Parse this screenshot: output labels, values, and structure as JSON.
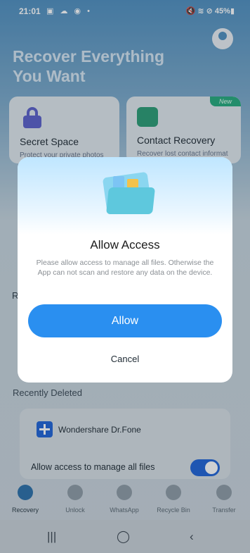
{
  "status_bar": {
    "time": "21:01",
    "left_icons": "▣ ☁ ◉ •",
    "right_icons": "🔇 ≋ ⊘ 45%▮",
    "battery": "45%"
  },
  "header": {
    "title_line1": "Recover Everything",
    "title_line2": "You Want"
  },
  "cards": {
    "secret_space": {
      "title": "Secret Space",
      "subtitle": "Protect your private photos"
    },
    "contact_recovery": {
      "title": "Contact Recovery",
      "subtitle": "Recover lost contact information",
      "badge": "New"
    }
  },
  "section_letter": "R",
  "recent": {
    "label": "Recently Deleted",
    "app_name": "Wondershare Dr.Fone",
    "access_text": "Allow access to manage all files",
    "toggle_on": true
  },
  "bottom_nav": [
    {
      "label": "Recovery",
      "active": true
    },
    {
      "label": "Unlock",
      "active": false
    },
    {
      "label": "WhatsApp",
      "active": false
    },
    {
      "label": "Recycle Bin",
      "active": false
    },
    {
      "label": "Transfer",
      "active": false
    }
  ],
  "system_nav": {
    "recents": "|||",
    "home": "◯",
    "back": "‹"
  },
  "dialog": {
    "title": "Allow Access",
    "message": "Please allow access to manage all files. Otherwise the App can not scan and restore any data on the device.",
    "allow_label": "Allow",
    "cancel_label": "Cancel"
  },
  "colors": {
    "primary": "#2a8ff0",
    "toggle": "#1f63d6",
    "badge": "#25a97b"
  }
}
